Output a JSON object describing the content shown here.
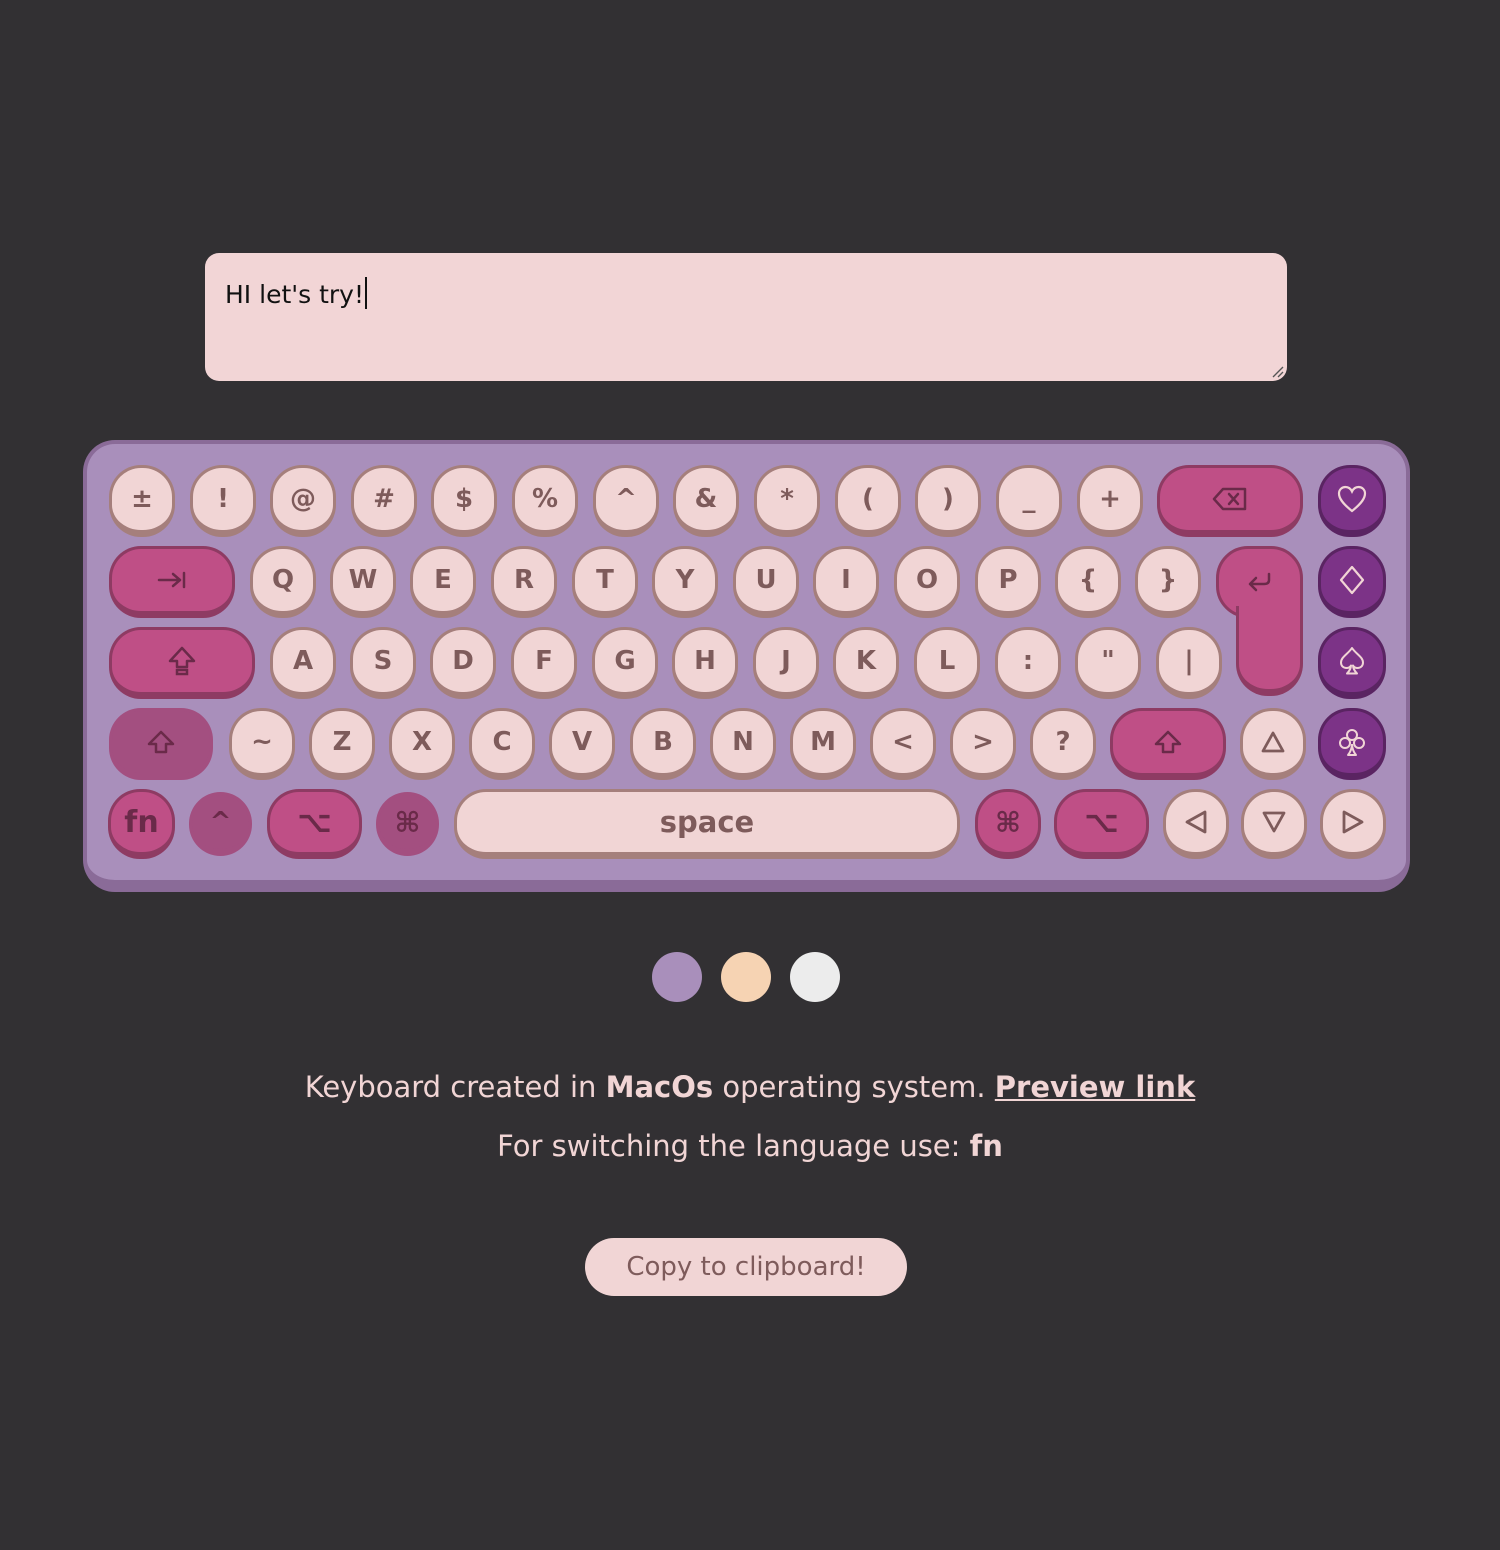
{
  "editor": {
    "text": "HI let's try!"
  },
  "keyboard": {
    "row1": [
      "±",
      "!",
      "@",
      "#",
      "$",
      "%",
      "^",
      "&",
      "*",
      "(",
      ")",
      "_",
      "+"
    ],
    "row2": [
      "Q",
      "W",
      "E",
      "R",
      "T",
      "Y",
      "U",
      "I",
      "O",
      "P",
      "{",
      "}"
    ],
    "row3": [
      "A",
      "S",
      "D",
      "F",
      "G",
      "H",
      "J",
      "K",
      "L",
      ":",
      "\"",
      "|"
    ],
    "row4": [
      "~",
      "Z",
      "X",
      "C",
      "V",
      "B",
      "N",
      "M",
      "<",
      ">",
      "?"
    ],
    "fn": "fn",
    "ctrl": "^",
    "option": "⌥",
    "command": "⌘",
    "space": "space"
  },
  "themes": [
    {
      "name": "lavender",
      "color": "#a98fbb"
    },
    {
      "name": "peach",
      "color": "#f6d3b3"
    },
    {
      "name": "white",
      "color": "#ececec"
    }
  ],
  "info": {
    "line1_pre": "Keyboard created in ",
    "line1_bold": "MacOs",
    "line1_post": " operating system. ",
    "line1_link": "Preview link",
    "line2_pre": "For switching the language use: ",
    "line2_bold": "fn"
  },
  "copy_button": "Copy to clipboard!",
  "colors": {
    "background": "#323033",
    "key": "#f1d5d5",
    "key_accent": "#bf4f86",
    "key_suit": "#7c3387",
    "keyboard_body": "#a98fbb"
  }
}
